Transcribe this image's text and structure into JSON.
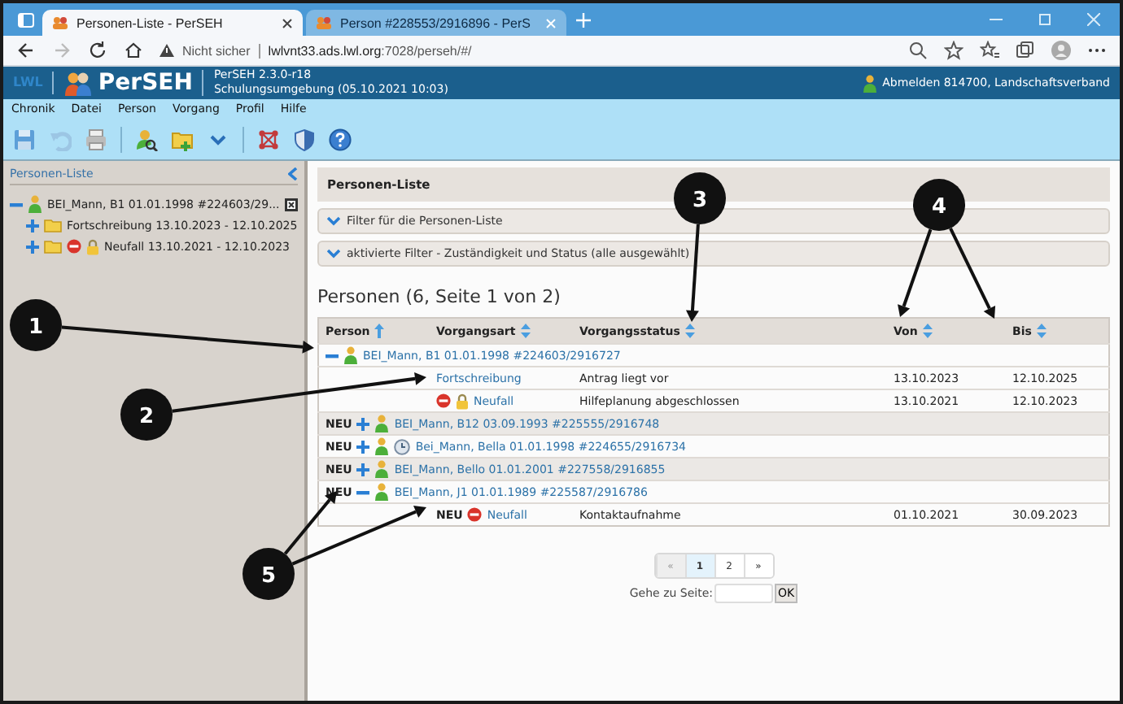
{
  "browser": {
    "tabs": [
      {
        "title": "Personen-Liste - PerSEH",
        "selected": true
      },
      {
        "title": "Person #228553/2916896 - PerS",
        "selected": false
      }
    ],
    "address": {
      "security": "Nicht sicher",
      "host": "lwlvnt33.ads.lwl.org",
      "path": ":7028/perseh/#/"
    }
  },
  "app": {
    "logo": "LWL",
    "name": "PerSEH",
    "version": "PerSEH 2.3.0-r18",
    "environment": "Schulungsumgebung (05.10.2021 10:03)",
    "user": "Abmelden 814700, Landschaftsverband"
  },
  "menu": [
    "Chronik",
    "Datei",
    "Person",
    "Vorgang",
    "Profil",
    "Hilfe"
  ],
  "sidebar": {
    "title": "Personen-Liste",
    "tree": [
      {
        "label": "BEI_Mann, B1 01.01.1998 #224603/29...",
        "expanded": true,
        "children": [
          {
            "label": "Fortschreibung 13.10.2023 - 12.10.2025",
            "expanded": false,
            "blocked": false,
            "locked": false
          },
          {
            "label": "Neufall 13.10.2021 - 12.10.2023",
            "expanded": false,
            "blocked": true,
            "locked": true
          }
        ]
      }
    ]
  },
  "panel": {
    "title": "Personen-Liste",
    "filters": [
      "Filter für die Personen-Liste",
      "aktivierte Filter - Zuständigkeit und Status (alle ausgewählt)"
    ],
    "heading": "Personen (6, Seite 1 von 2)"
  },
  "table": {
    "columns": [
      "Person",
      "Vorgangsart",
      "Vorgangsstatus",
      "Von",
      "Bis"
    ],
    "rows": [
      {
        "kind": "person",
        "expanded": true,
        "clock": false,
        "label": "BEI_Mann, B1 01.01.1998 #224603/2916727"
      },
      {
        "kind": "case",
        "blocked": false,
        "locked": false,
        "type": "Fortschreibung",
        "status": "Antrag liegt vor",
        "von": "13.10.2023",
        "bis": "12.10.2025"
      },
      {
        "kind": "case",
        "blocked": true,
        "locked": true,
        "type": "Neufall",
        "status": "Hilfeplanung abgeschlossen",
        "von": "13.10.2021",
        "bis": "12.10.2023"
      },
      {
        "kind": "person",
        "badge": "NEU",
        "expanded": false,
        "clock": false,
        "label": "BEI_Mann, B12 03.09.1993 #225555/2916748"
      },
      {
        "kind": "person",
        "badge": "NEU",
        "expanded": false,
        "clock": true,
        "label": "Bei_Mann, Bella 01.01.1998 #224655/2916734"
      },
      {
        "kind": "person",
        "badge": "NEU",
        "expanded": false,
        "clock": false,
        "label": "BEI_Mann, Bello 01.01.2001 #227558/2916855"
      },
      {
        "kind": "person",
        "badge": "NEU",
        "expanded": true,
        "clock": false,
        "label": "BEI_Mann, J1 01.01.1989 #225587/2916786"
      },
      {
        "kind": "case",
        "type_badge": "NEU",
        "blocked": true,
        "locked": false,
        "type": "Neufall",
        "status": "Kontaktaufnahme",
        "von": "01.10.2021",
        "bis": "30.09.2023"
      }
    ]
  },
  "pagination": {
    "pages": [
      {
        "label": "«",
        "selected": false,
        "disabled": true
      },
      {
        "label": "1",
        "selected": true,
        "disabled": false
      },
      {
        "label": "2",
        "selected": false,
        "disabled": false
      },
      {
        "label": "»",
        "selected": false,
        "disabled": false
      }
    ],
    "goto_label": "Gehe zu Seite:",
    "goto_button": "OK"
  },
  "annotations": [
    {
      "label": "1"
    },
    {
      "label": "2"
    },
    {
      "label": "3"
    },
    {
      "label": "4"
    },
    {
      "label": "5"
    }
  ]
}
